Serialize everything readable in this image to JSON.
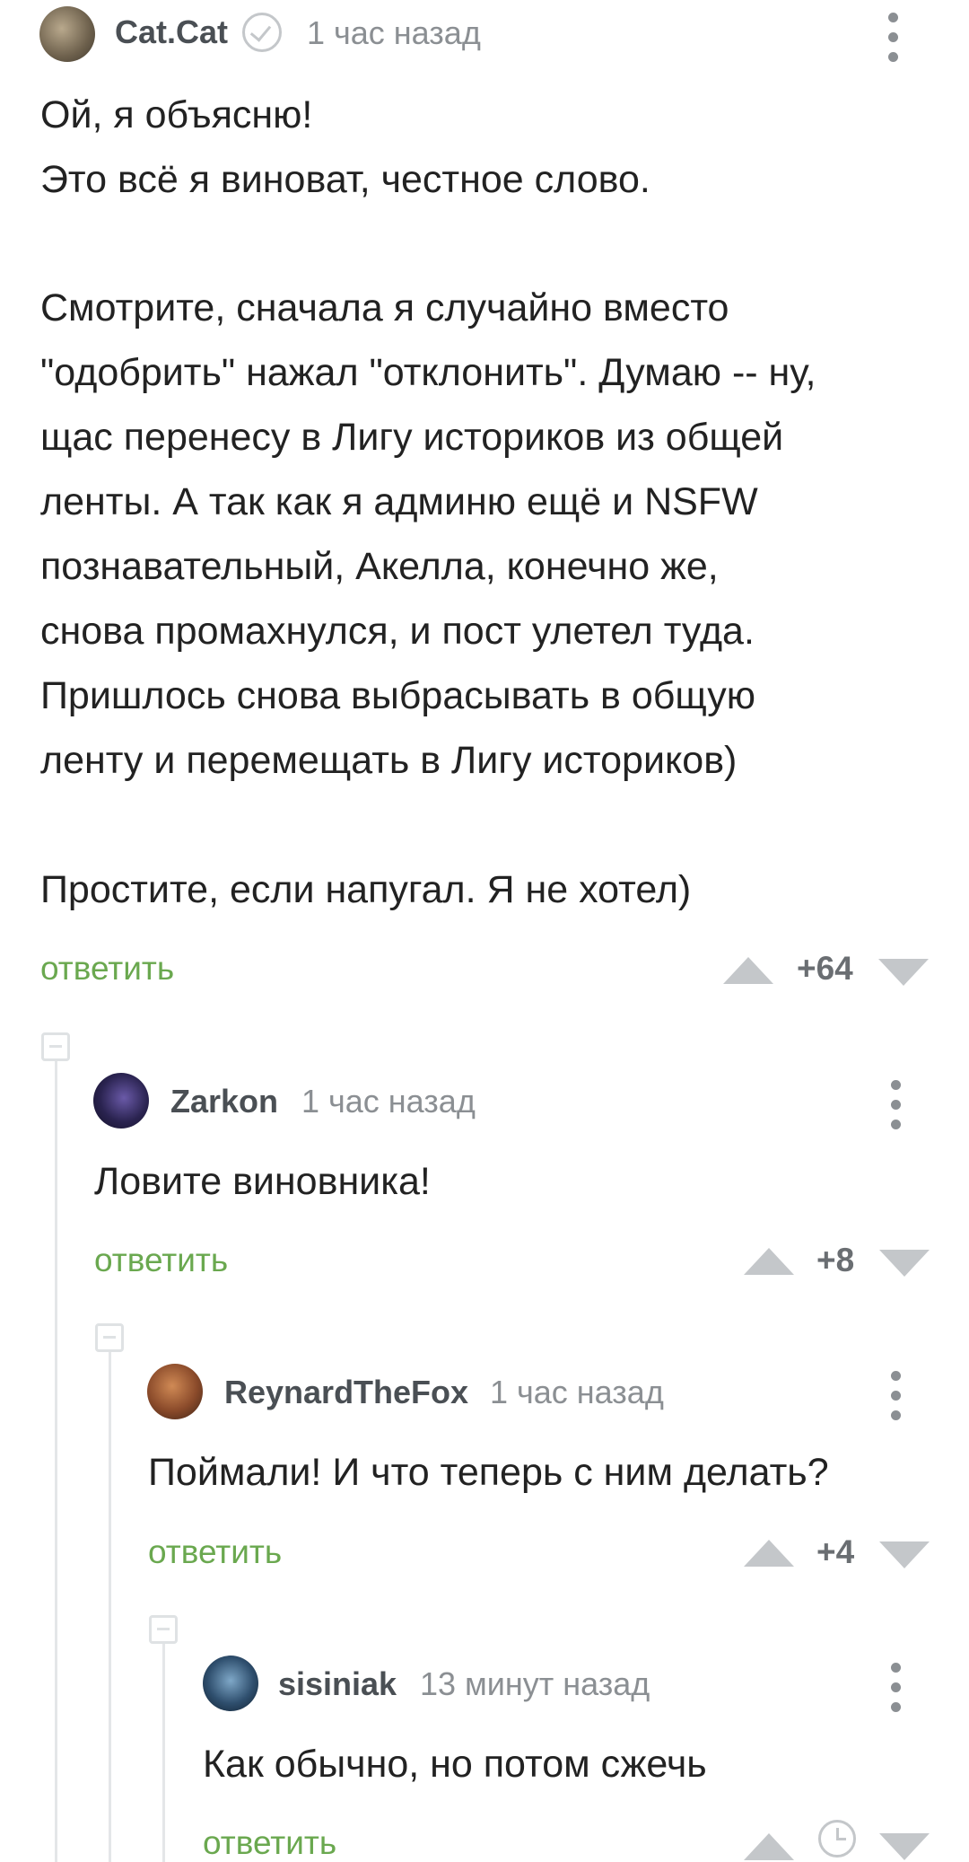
{
  "comments": [
    {
      "author": "Cat.Cat",
      "time": "1 час назад",
      "lines": [
        "Ой, я объясню!",
        "Это всё я виноват, честное слово.",
        "",
        "Смотрите, сначала я случайно вместо",
        "\"одобрить\" нажал \"отклонить\". Думаю -- ну,",
        "щас перенесу в Лигу историков из общей",
        "ленты. А так как я админю ещё и NSFW",
        "познавательный, Акелла, конечно же,",
        "снова промахнулся, и пост улетел туда.",
        "Пришлось снова выбрасывать в общую",
        "ленту и перемещать в Лигу историков)",
        "",
        "Простите, если напугал. Я не хотел)"
      ],
      "reply": "ответить",
      "score": "+64"
    },
    {
      "author": "Zarkon",
      "time": "1 час назад",
      "lines": [
        "Ловите виновника!"
      ],
      "reply": "ответить",
      "score": "+8"
    },
    {
      "author": "ReynardTheFox",
      "time": "1 час назад",
      "lines": [
        "Поймали! И что теперь с ним делать?"
      ],
      "reply": "ответить",
      "score": "+4"
    },
    {
      "author": "sisiniak",
      "time": "13 минут назад",
      "lines": [
        "Как обычно, но потом сжечь"
      ],
      "reply": "ответить"
    }
  ],
  "colors": {
    "reply_link": "#6aa84f",
    "author": "#4a4f54",
    "meta": "#8b8f93",
    "vote_arrow": "#c4c7ca"
  },
  "icons": [
    "verified-icon",
    "more-icon",
    "upvote-icon",
    "downvote-icon",
    "collapse-icon",
    "clock-icon"
  ]
}
